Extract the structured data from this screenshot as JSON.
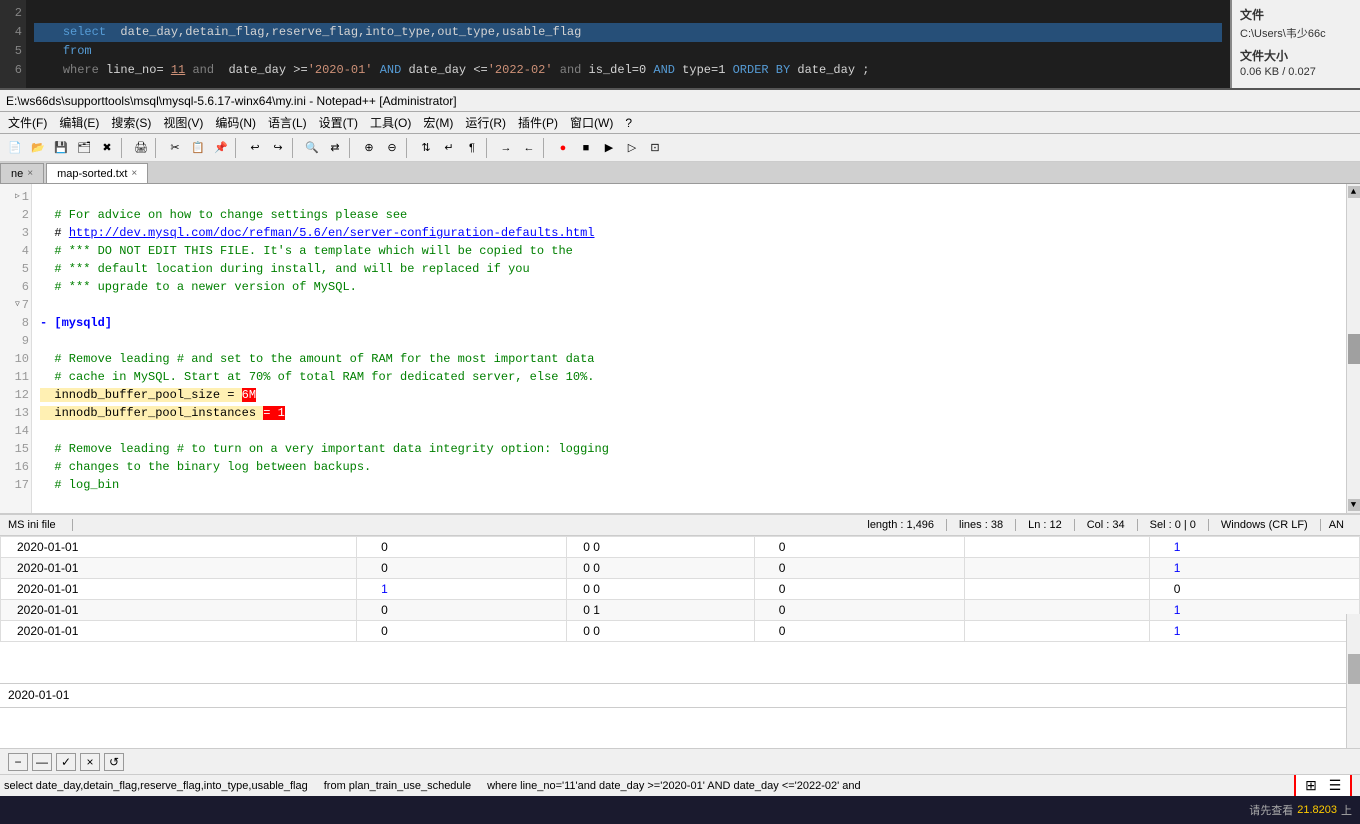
{
  "top_area": {
    "line_numbers": [
      "2",
      "4",
      "5",
      "6"
    ],
    "sql_lines": [
      "    select  date_day,detain_flag,reserve_flag,into_type,out_type,usable_flag",
      "    from",
      "    where line_no= 11 and  date_day >='2020-01' AND date_day <='2022-02' and is_del=0 AND type=1 ORDER BY date_day ;",
      "",
      ""
    ]
  },
  "right_panel": {
    "label1": "文件",
    "path": "C:\\Users\\韦少66c",
    "label2": "文件大小",
    "size": "0.06 KB / 0.027"
  },
  "titlebar": {
    "text": "E:\\ws66ds\\supporttools\\msql\\mysql-5.6.17-winx64\\my.ini - Notepad++ [Administrator]"
  },
  "menubar": {
    "items": [
      "文件(F)",
      "编辑(E)",
      "搜索(S)",
      "视图(V)",
      "编码(N)",
      "语言(L)",
      "设置(T)",
      "工具(O)",
      "宏(M)",
      "运行(R)",
      "插件(P)",
      "窗口(W)",
      "?"
    ]
  },
  "tabs": [
    {
      "label": "ne",
      "active": false
    },
    {
      "label": "map-sorted.txt",
      "active": true
    }
  ],
  "editor": {
    "lines": [
      {
        "num": "1",
        "content": "  # For advice on how to change settings please see",
        "type": "comment"
      },
      {
        "num": "2",
        "content": "  # http://dev.mysql.com/doc/refman/5.6/en/server-configuration-defaults.html",
        "type": "link-line"
      },
      {
        "num": "3",
        "content": "  # *** DO NOT EDIT THIS FILE. It's a template which will be copied to the",
        "type": "comment"
      },
      {
        "num": "4",
        "content": "  # *** default location during install, and will be replaced if you",
        "type": "comment"
      },
      {
        "num": "5",
        "content": "  # *** upgrade to a newer version of MySQL.",
        "type": "comment"
      },
      {
        "num": "6",
        "content": "",
        "type": "empty"
      },
      {
        "num": "7",
        "content": "- [mysqld]",
        "type": "section"
      },
      {
        "num": "8",
        "content": "",
        "type": "empty"
      },
      {
        "num": "9",
        "content": "  # Remove leading # and set to the amount of RAM for the most important data",
        "type": "comment"
      },
      {
        "num": "10",
        "content": "  # cache in MySQL. Start at 70% of total RAM for dedicated server, else 10%.",
        "type": "comment"
      },
      {
        "num": "11",
        "content": "  innodb_buffer_pool_size = 6M",
        "type": "highlighted-line"
      },
      {
        "num": "12",
        "content": "  innodb_buffer_pool_instances = 1",
        "type": "highlighted-line2"
      },
      {
        "num": "13",
        "content": "",
        "type": "empty"
      },
      {
        "num": "14",
        "content": "  # Remove leading # to turn on a very important data integrity option: logging",
        "type": "comment"
      },
      {
        "num": "15",
        "content": "  # changes to the binary log between backups.",
        "type": "comment"
      },
      {
        "num": "16",
        "content": "  # log_bin",
        "type": "comment"
      },
      {
        "num": "17",
        "content": "",
        "type": "empty"
      }
    ]
  },
  "status_bar": {
    "filename": "MS ini file",
    "length_label": "length : 1,496",
    "lines_label": "lines : 38",
    "ln_label": "Ln : 12",
    "col_label": "Col : 34",
    "sel_label": "Sel : 0 | 0",
    "encoding": "Windows (CR LF)",
    "extra": "AN"
  },
  "data_table": {
    "rows": [
      [
        "2020-01-01",
        "0",
        "0 0",
        "0",
        "",
        "1"
      ],
      [
        "2020-01-01",
        "0",
        "0 0",
        "0",
        "",
        "1"
      ],
      [
        "2020-01-01",
        "1",
        "0 0",
        "0",
        "",
        "0"
      ],
      [
        "2020-01-01",
        "0",
        "0 1",
        "0",
        "",
        "1"
      ],
      [
        "2020-01-01",
        "0",
        "0 0",
        "0",
        "",
        "1"
      ]
    ]
  },
  "single_row": {
    "value": "2020-01-01"
  },
  "bottom_buttons": [
    "-",
    "—",
    "✓",
    "×",
    "↺"
  ],
  "sql_bottom": {
    "select_part": "select   date_day,detain_flag,reserve_flag,into_type,usable_flag",
    "from_part": "from plan_train_use_schedule",
    "where_part": "where line_no='11'and  date_day >='2020-01' AND date_day <='2022-02' and"
  },
  "table_icons": {
    "icon1": "⊞",
    "icon2": "☰"
  },
  "taskbar": {
    "right_text": "请先查看 21.8203"
  }
}
